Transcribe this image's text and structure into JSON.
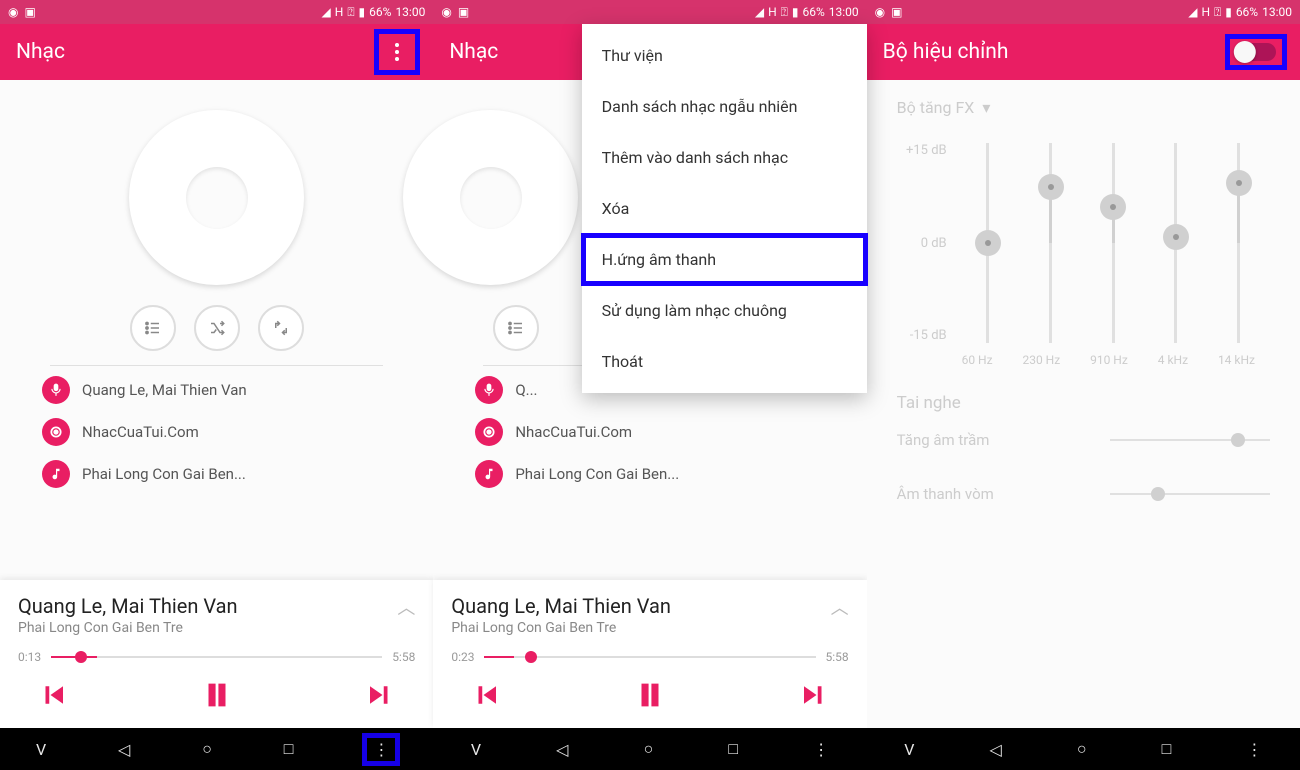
{
  "status": {
    "battery": "66%",
    "time": "13:00",
    "network_h": "H"
  },
  "screen1": {
    "title": "Nhạc",
    "artist": "Quang Le, Mai Thien Van",
    "source": "NhacCuaTui.Com",
    "song_trunc": "Phai Long Con Gai Ben...",
    "np_title": "Quang Le, Mai Thien Van",
    "np_sub": "Phai Long Con Gai Ben Tre",
    "elapsed": "0:13",
    "duration": "5:58",
    "progress_pct": 9
  },
  "screen2": {
    "title": "Nhạc",
    "menu": [
      {
        "label": "Thư viện",
        "hl": false
      },
      {
        "label": "Danh sách nhạc ngẫu nhiên",
        "hl": false
      },
      {
        "label": "Thêm vào danh sách nhạc",
        "hl": false
      },
      {
        "label": "Xóa",
        "hl": false
      },
      {
        "label": "H.ứng âm thanh",
        "hl": true
      },
      {
        "label": "Sử dụng làm nhạc chuông",
        "hl": false
      },
      {
        "label": "Thoát",
        "hl": false
      }
    ],
    "artist_trunc": "Q...",
    "source": "NhacCuaTui.Com",
    "song_trunc": "Phai Long Con Gai Ben...",
    "np_title": "Quang Le, Mai Thien Van",
    "np_sub": "Phai Long Con Gai Ben Tre",
    "elapsed": "0:23",
    "duration": "5:58",
    "progress_pct": 14
  },
  "screen3": {
    "title": "Bộ hiệu chỉnh",
    "booster": "Bộ tăng FX",
    "db_labels": [
      "+15 dB",
      "0 dB",
      "-15 dB"
    ],
    "bands": [
      {
        "freq": "60 Hz",
        "value_db": 0,
        "thumb_pct": 50
      },
      {
        "freq": "230 Hz",
        "value_db": 8,
        "thumb_pct": 22
      },
      {
        "freq": "910 Hz",
        "value_db": 5,
        "thumb_pct": 32
      },
      {
        "freq": "4 kHz",
        "value_db": 1,
        "thumb_pct": 47
      },
      {
        "freq": "14 kHz",
        "value_db": 9,
        "thumb_pct": 20
      }
    ],
    "headphone_section": "Tai nghe",
    "bass_boost": "Tăng âm trầm",
    "surround": "Âm thanh vòm",
    "toggle_on": false
  }
}
